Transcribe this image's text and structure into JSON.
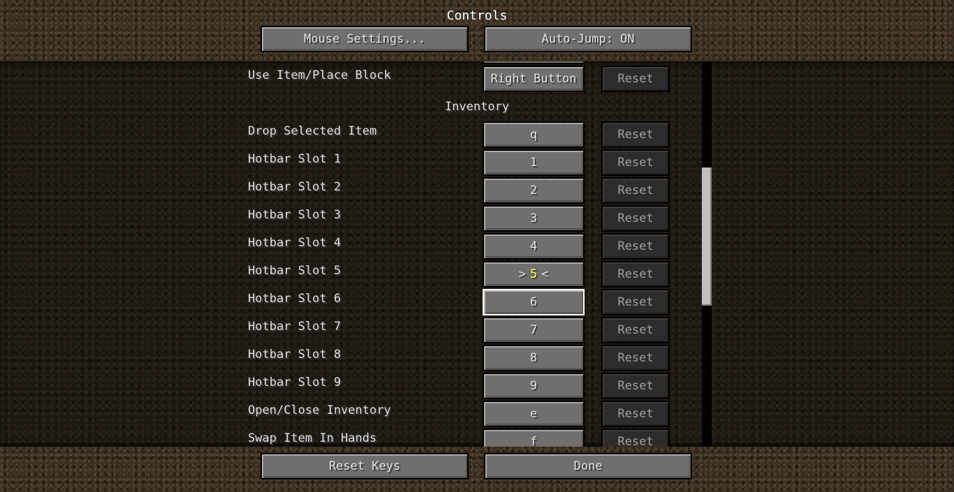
{
  "header": {
    "title": "Controls",
    "mouse_settings_label": "Mouse Settings...",
    "auto_jump_label": "Auto-Jump: ON"
  },
  "bindings": {
    "reset_label": "Reset",
    "use_item": {
      "label": "Use Item/Place Block",
      "key": "Right Button"
    },
    "inventory_category": "Inventory",
    "rows": [
      {
        "label": "Drop Selected Item",
        "key": "q"
      },
      {
        "label": "Hotbar Slot 1",
        "key": "1"
      },
      {
        "label": "Hotbar Slot 2",
        "key": "2"
      },
      {
        "label": "Hotbar Slot 3",
        "key": "3"
      },
      {
        "label": "Hotbar Slot 4",
        "key": "4"
      },
      {
        "label": "Hotbar Slot 5",
        "key_left": ">",
        "key": "5",
        "key_right": "<"
      },
      {
        "label": "Hotbar Slot 6",
        "key": "6"
      },
      {
        "label": "Hotbar Slot 7",
        "key": "7"
      },
      {
        "label": "Hotbar Slot 8",
        "key": "8"
      },
      {
        "label": "Hotbar Slot 9",
        "key": "9"
      },
      {
        "label": "Open/Close Inventory",
        "key": "e"
      },
      {
        "label": "Swap Item In Hands",
        "key": "f"
      }
    ]
  },
  "footer": {
    "reset_keys_label": "Reset Keys",
    "done_label": "Done"
  },
  "colors": {
    "listening_key": "#ffff55",
    "button_face": "#6f6f6f",
    "disabled_face": "#2c2c2c"
  },
  "scroll": {
    "position_fraction": 0.5
  }
}
